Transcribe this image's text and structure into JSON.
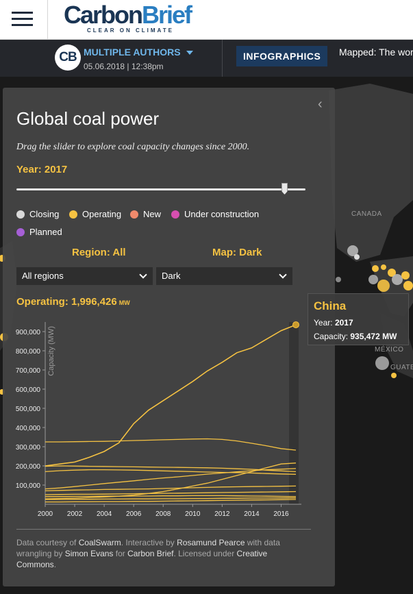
{
  "header": {
    "logo_part1": "Carbon",
    "logo_part2": "Brief",
    "logo_tagline": "CLEAR ON CLIMATE"
  },
  "byline": {
    "avatar": "CB",
    "author": "MULTIPLE AUTHORS",
    "date": "05.06.2018 | 12:38pm",
    "category": "INFOGRAPHICS",
    "article_title": "Mapped: The world's coal power plants"
  },
  "panel": {
    "title": "Global coal power",
    "subtitle": "Drag the slider to explore coal capacity changes since 2000.",
    "year_label": "Year: 2017",
    "slider": {
      "min": 2000,
      "max": 2017,
      "value": 2017
    },
    "legend": [
      {
        "label": "Closing",
        "color": "#d9d9d9"
      },
      {
        "label": "Operating",
        "color": "#f5c242"
      },
      {
        "label": "New",
        "color": "#f08a6c"
      },
      {
        "label": "Under construction",
        "color": "#d64fb0"
      },
      {
        "label": "Planned",
        "color": "#a65fd6"
      }
    ],
    "region_label": "Region: All",
    "map_label": "Map: Dark",
    "region_select": "All regions",
    "map_select": "Dark",
    "operating_label": "Operating: 1,996,426",
    "operating_unit": "MW",
    "footer": {
      "p1": "Data courtesy of ",
      "coalswarm": "CoalSwarm",
      "p2": ". Interactive by ",
      "rosamund": "Rosamund Pearce",
      "p3": " with data wrangling by ",
      "simon": "Simon Evans",
      "p4": " for ",
      "carbonbrief": "Carbon Brief",
      "p5": ". Licensed under ",
      "cc": "Creative Commons",
      "p6": "."
    }
  },
  "tooltip": {
    "name": "China",
    "year_label": "Year:",
    "year": "2017",
    "capacity_label": "Capacity:",
    "capacity": "935,472 MW"
  },
  "map_labels": {
    "canada": "CANADA",
    "mexico": "MÉXICO",
    "guat": "GUATE"
  },
  "chart_data": {
    "type": "line",
    "ylabel": "Capacity (MW)",
    "ylim": [
      0,
      950000
    ],
    "yticks": [
      "100,000",
      "200,000",
      "300,000",
      "400,000",
      "500,000",
      "600,000",
      "700,000",
      "800,000",
      "900,000"
    ],
    "yticks_values": [
      100000,
      200000,
      300000,
      400000,
      500000,
      600000,
      700000,
      800000,
      900000
    ],
    "xlim": [
      2000,
      2017
    ],
    "xticks": [
      "2000",
      "2002",
      "2004",
      "2006",
      "2008",
      "2010",
      "2012",
      "2014",
      "2016"
    ],
    "xticks_values": [
      2000,
      2002,
      2004,
      2006,
      2008,
      2010,
      2012,
      2014,
      2016
    ],
    "x": [
      2000,
      2001,
      2002,
      2003,
      2004,
      2005,
      2006,
      2007,
      2008,
      2009,
      2010,
      2011,
      2012,
      2013,
      2014,
      2015,
      2016,
      2017
    ],
    "highlight": {
      "series": "China",
      "x": 2017,
      "y": 935472
    },
    "series": [
      {
        "name": "China",
        "values": [
          200000,
          210000,
          220000,
          245000,
          275000,
          320000,
          420000,
          490000,
          540000,
          590000,
          640000,
          695000,
          740000,
          790000,
          815000,
          860000,
          905000,
          935472
        ]
      },
      {
        "values": [
          325000,
          325000,
          326000,
          327000,
          328000,
          330000,
          332000,
          334000,
          336000,
          338000,
          340000,
          341000,
          338000,
          330000,
          318000,
          305000,
          290000,
          282000
        ]
      },
      {
        "values": [
          198000,
          200000,
          199000,
          198000,
          197000,
          196000,
          195000,
          194000,
          193000,
          192000,
          191000,
          190000,
          188000,
          185000,
          182000,
          178000,
          174000,
          170000
        ]
      },
      {
        "values": [
          80000,
          85000,
          92000,
          100000,
          108000,
          115000,
          122000,
          130000,
          137000,
          143000,
          150000,
          157000,
          163000,
          169000,
          175000,
          180000,
          183000,
          186000
        ]
      },
      {
        "values": [
          28000,
          30000,
          32000,
          35000,
          38000,
          42000,
          48000,
          56000,
          66000,
          80000,
          95000,
          110000,
          130000,
          150000,
          170000,
          190000,
          210000,
          215000
        ]
      },
      {
        "values": [
          170000,
          175000,
          178000,
          180000,
          180000,
          179000,
          178000,
          176000,
          174000,
          172000,
          170000,
          168000,
          166000,
          165000,
          163000,
          160000,
          158000,
          156000
        ]
      },
      {
        "values": [
          70000,
          72000,
          74000,
          75000,
          77000,
          78000,
          79000,
          80000,
          82000,
          84000,
          86000,
          88000,
          90000,
          91000,
          92000,
          93000,
          94000,
          95000
        ]
      },
      {
        "values": [
          50000,
          51000,
          52000,
          52000,
          53000,
          54000,
          55000,
          56000,
          57000,
          58000,
          59000,
          60000,
          61000,
          62000,
          63000,
          64000,
          65000,
          66000
        ]
      },
      {
        "values": [
          40000,
          40000,
          41000,
          41000,
          42000,
          42000,
          43000,
          43000,
          44000,
          44000,
          45000,
          45000,
          45000,
          44000,
          43000,
          42000,
          41000,
          40000
        ]
      },
      {
        "values": [
          25000,
          25000,
          26000,
          26000,
          27000,
          27000,
          28000,
          28000,
          29000,
          29000,
          30000,
          30000,
          31000,
          31000,
          32000,
          32000,
          33000,
          33000
        ]
      },
      {
        "values": [
          12000,
          12000,
          13000,
          13000,
          14000,
          14000,
          15000,
          15000,
          16000,
          17000,
          18000,
          19000,
          20000,
          21000,
          22000,
          23000,
          24000,
          25000
        ]
      }
    ]
  }
}
